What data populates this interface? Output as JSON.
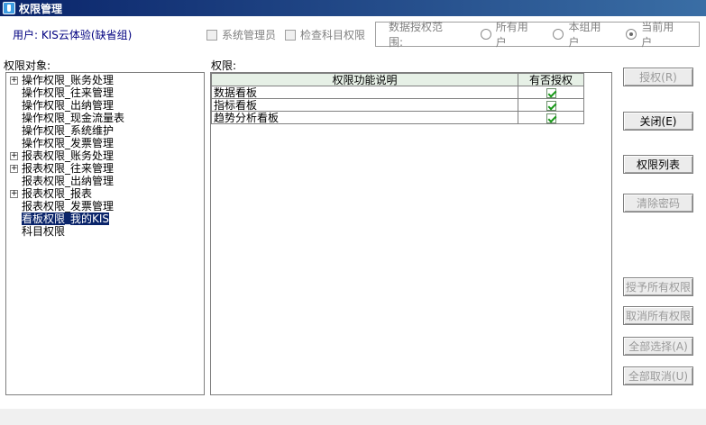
{
  "window": {
    "title": "权限管理"
  },
  "header": {
    "user_text": "用户: KIS云体验(缺省组)",
    "checkboxes": [
      {
        "label": "系统管理员",
        "checked": false
      },
      {
        "label": "检查科目权限",
        "checked": false
      }
    ],
    "scope": {
      "label": "数据授权范围:",
      "options": [
        {
          "label": "所有用户",
          "selected": false
        },
        {
          "label": "本组用户",
          "selected": false
        },
        {
          "label": "当前用户",
          "selected": true
        }
      ]
    }
  },
  "tree": {
    "label": "权限对象:",
    "items": [
      {
        "label": "操作权限_账务处理",
        "expandable": true,
        "selected": false
      },
      {
        "label": "操作权限_往来管理",
        "expandable": false,
        "selected": false
      },
      {
        "label": "操作权限_出纳管理",
        "expandable": false,
        "selected": false
      },
      {
        "label": "操作权限_现金流量表",
        "expandable": false,
        "selected": false
      },
      {
        "label": "操作权限_系统维护",
        "expandable": false,
        "selected": false
      },
      {
        "label": "操作权限_发票管理",
        "expandable": false,
        "selected": false
      },
      {
        "label": "报表权限_账务处理",
        "expandable": true,
        "selected": false
      },
      {
        "label": "报表权限_往来管理",
        "expandable": true,
        "selected": false
      },
      {
        "label": "报表权限_出纳管理",
        "expandable": false,
        "selected": false
      },
      {
        "label": "报表权限_报表",
        "expandable": true,
        "selected": false
      },
      {
        "label": "报表权限_发票管理",
        "expandable": false,
        "selected": false
      },
      {
        "label": "看板权限_我的KIS",
        "expandable": false,
        "selected": true
      },
      {
        "label": "科目权限",
        "expandable": false,
        "selected": false
      }
    ]
  },
  "grid": {
    "label": "权限:",
    "columns": [
      "权限功能说明",
      "有否授权"
    ],
    "rows": [
      {
        "desc": "数据看板",
        "granted": true
      },
      {
        "desc": "指标看板",
        "granted": true
      },
      {
        "desc": "趋势分析看板",
        "granted": true
      }
    ]
  },
  "buttons": {
    "grant": "授权(R)",
    "close": "关闭(E)",
    "perm_list": "权限列表",
    "clear_password": "清除密码",
    "grant_all": "授予所有权限",
    "revoke_all": "取消所有权限",
    "select_all": "全部选择(A)",
    "deselect_all": "全部取消(U)"
  }
}
